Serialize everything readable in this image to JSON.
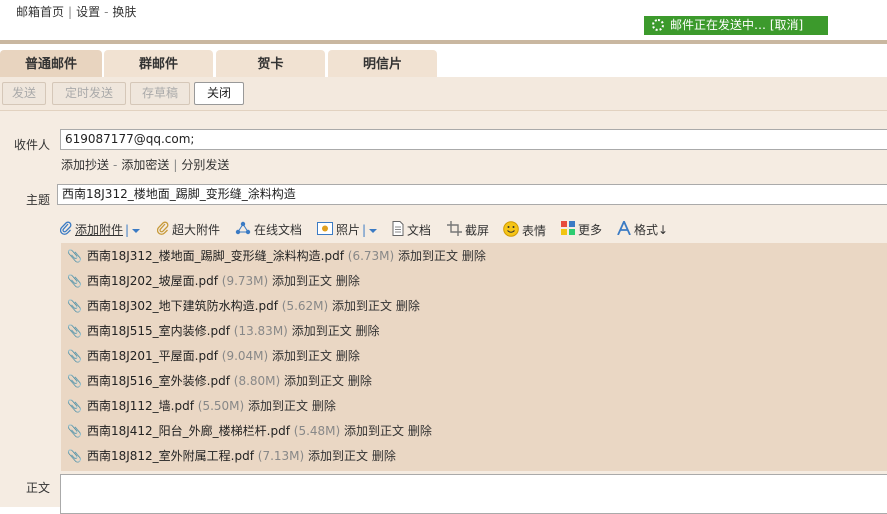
{
  "top_links": [
    "邮箱首页",
    "设置",
    "换肤"
  ],
  "top_sep1": "|",
  "top_sep2": "-",
  "sending_status": "邮件正在发送中… [取消]",
  "tabs": [
    {
      "label": "普通邮件",
      "active": true
    },
    {
      "label": "群邮件",
      "active": false
    },
    {
      "label": "贺卡",
      "active": false
    },
    {
      "label": "明信片",
      "active": false
    }
  ],
  "toolbar": {
    "send": "发送",
    "scheduled": "定时发送",
    "draft": "存草稿",
    "close": "关闭"
  },
  "recipient_label": "收件人",
  "recipient_value": "619087177@qq.com;",
  "recipient_links": {
    "cc": "添加抄送",
    "bcc": "添加密送",
    "separate": "分别发送",
    "sep_dash": "-",
    "sep_bar": "|"
  },
  "subject_label": "主题",
  "subject_value": "西南18J312_楼地面_踢脚_变形缝_涂料构造",
  "attach_toolbar": [
    {
      "label": "添加附件",
      "icon": "paperclip-icon"
    },
    {
      "label": "超大附件",
      "icon": "large-attachment-icon"
    },
    {
      "label": "在线文档",
      "icon": "online-doc-icon"
    },
    {
      "label": "照片",
      "icon": "photo-icon"
    },
    {
      "label": "文档",
      "icon": "document-icon"
    },
    {
      "label": "截屏",
      "icon": "screenshot-icon"
    },
    {
      "label": "表情",
      "icon": "emoji-icon"
    },
    {
      "label": "更多",
      "icon": "more-icon"
    },
    {
      "label": "格式↓",
      "icon": "format-icon"
    }
  ],
  "attachments": [
    {
      "name": "西南18J312_楼地面_踢脚_变形缝_涂料构造.pdf",
      "size": "(6.73M)"
    },
    {
      "name": "西南18J202_坡屋面.pdf",
      "size": "(9.73M)"
    },
    {
      "name": "西南18J302_地下建筑防水构造.pdf",
      "size": "(5.62M)"
    },
    {
      "name": "西南18J515_室内装修.pdf",
      "size": "(13.83M)"
    },
    {
      "name": "西南18J201_平屋面.pdf",
      "size": "(9.04M)"
    },
    {
      "name": "西南18J516_室外装修.pdf",
      "size": "(8.80M)"
    },
    {
      "name": "西南18J112_墙.pdf",
      "size": "(5.50M)"
    },
    {
      "name": "西南18J412_阳台_外廊_楼梯栏杆.pdf",
      "size": "(5.48M)"
    },
    {
      "name": "西南18J812_室外附属工程.pdf",
      "size": "(7.13M)"
    }
  ],
  "attach_actions": {
    "insert": "添加到正文",
    "delete": "删除"
  },
  "body_label": "正文",
  "colors": {
    "accent_green": "#3c9a2c",
    "panel": "#f5ece2",
    "tab": "#f1e2d2",
    "attachment_bg": "#ead7c4"
  }
}
